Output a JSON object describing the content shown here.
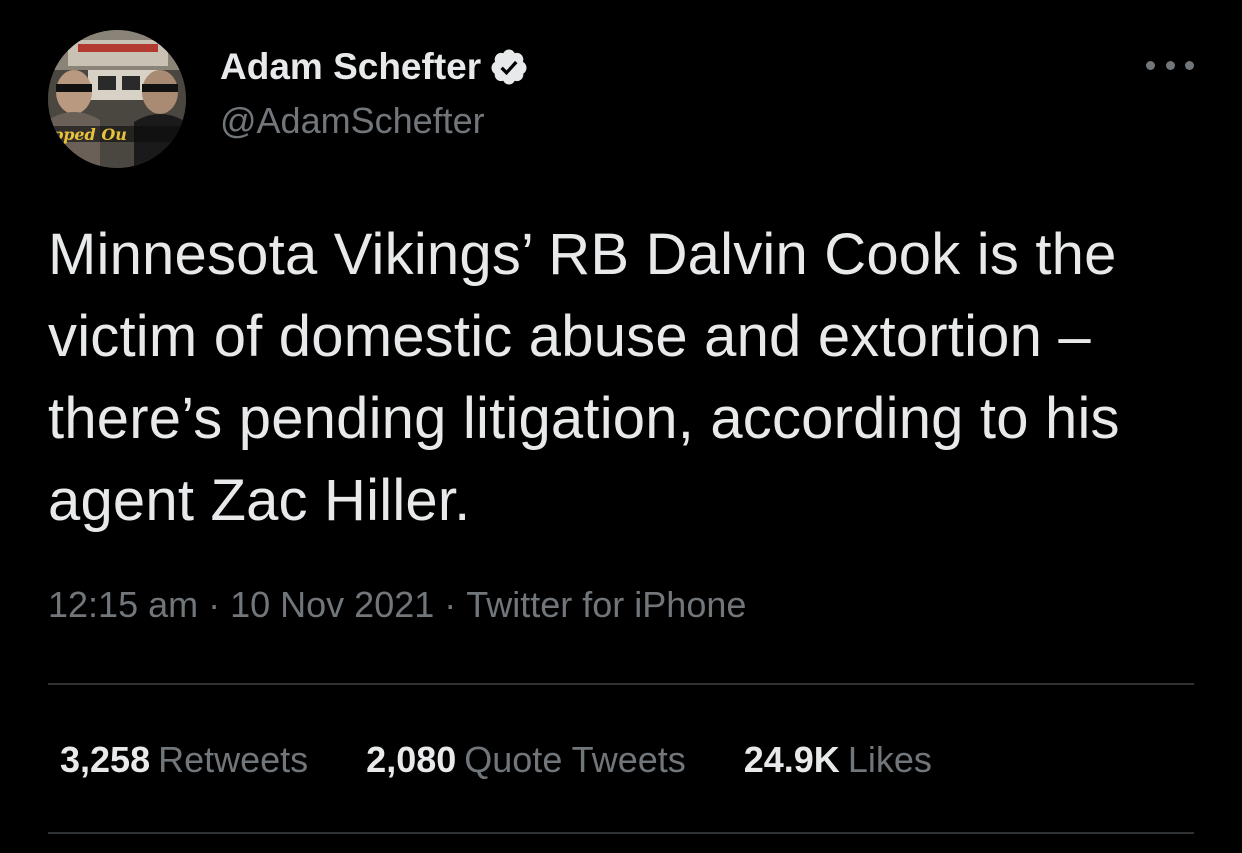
{
  "author": {
    "display_name": "Adam Schefter",
    "handle": "@AdamSchefter",
    "verified": true,
    "avatar_caption": "pped Ou"
  },
  "tweet": {
    "text": "Minnesota Vikings’ RB Dalvin Cook is the victim of domestic abuse and extortion – there’s pending litigation, according to his agent Zac Hiller.",
    "time": "12:15 am",
    "date": "10 Nov 2021",
    "source": "Twitter for iPhone",
    "separator": "·"
  },
  "stats": {
    "retweets_count": "3,258",
    "retweets_label": "Retweets",
    "quotes_count": "2,080",
    "quotes_label": "Quote Tweets",
    "likes_count": "24.9K",
    "likes_label": "Likes"
  },
  "colors": {
    "background": "#000000",
    "primary_text": "#e7e9ea",
    "secondary_text": "#71767b",
    "divider": "#2f3336",
    "verified_badge": "#e7e9ea"
  },
  "icons": {
    "verified": "verified-badge-icon",
    "more": "more-horizontal-icon"
  }
}
